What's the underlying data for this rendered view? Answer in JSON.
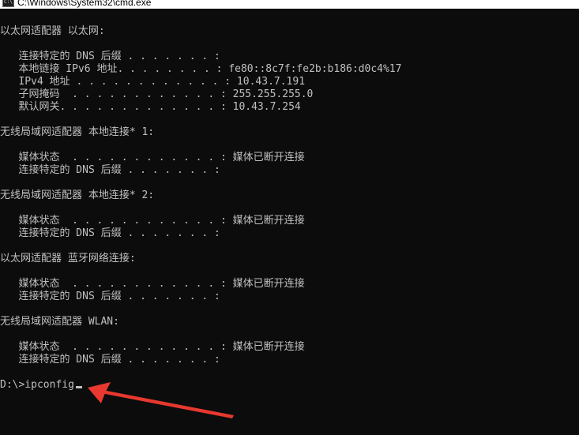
{
  "window": {
    "title": "C:\\Windows\\System32\\cmd.exe",
    "icon_name": "cmd-icon",
    "icon_glyph": "C:\\"
  },
  "console": {
    "lines": [
      "以太网适配器 以太网:",
      "   连接特定的 DNS 后缀 . . . . . . . :",
      "   本地链接 IPv6 地址. . . . . . . . : fe80::8c7f:fe2b:b186:d0c4%17",
      "   IPv4 地址 . . . . . . . . . . . . : 10.43.7.191",
      "   子网掩码  . . . . . . . . . . . . : 255.255.255.0",
      "   默认网关. . . . . . . . . . . . . : 10.43.7.254",
      "无线局域网适配器 本地连接* 1:",
      "   媒体状态  . . . . . . . . . . . . : 媒体已断开连接",
      "   连接特定的 DNS 后缀 . . . . . . . :",
      "无线局域网适配器 本地连接* 2:",
      "   媒体状态  . . . . . . . . . . . . : 媒体已断开连接",
      "   连接特定的 DNS 后缀 . . . . . . . :",
      "以太网适配器 蓝牙网络连接:",
      "   媒体状态  . . . . . . . . . . . . : 媒体已断开连接",
      "   连接特定的 DNS 后缀 . . . . . . . :",
      "无线局域网适配器 WLAN:",
      "   媒体状态  . . . . . . . . . . . . : 媒体已断开连接",
      "   连接特定的 DNS 后缀 . . . . . . . :",
      "D:\\>ipconfig"
    ]
  },
  "annotation": {
    "icon_name": "red-arrow-annotation",
    "color": "#e8382f"
  },
  "colors": {
    "background": "#0c0c0c",
    "text": "#c0c0c0",
    "titlebar": "#ffffff"
  }
}
